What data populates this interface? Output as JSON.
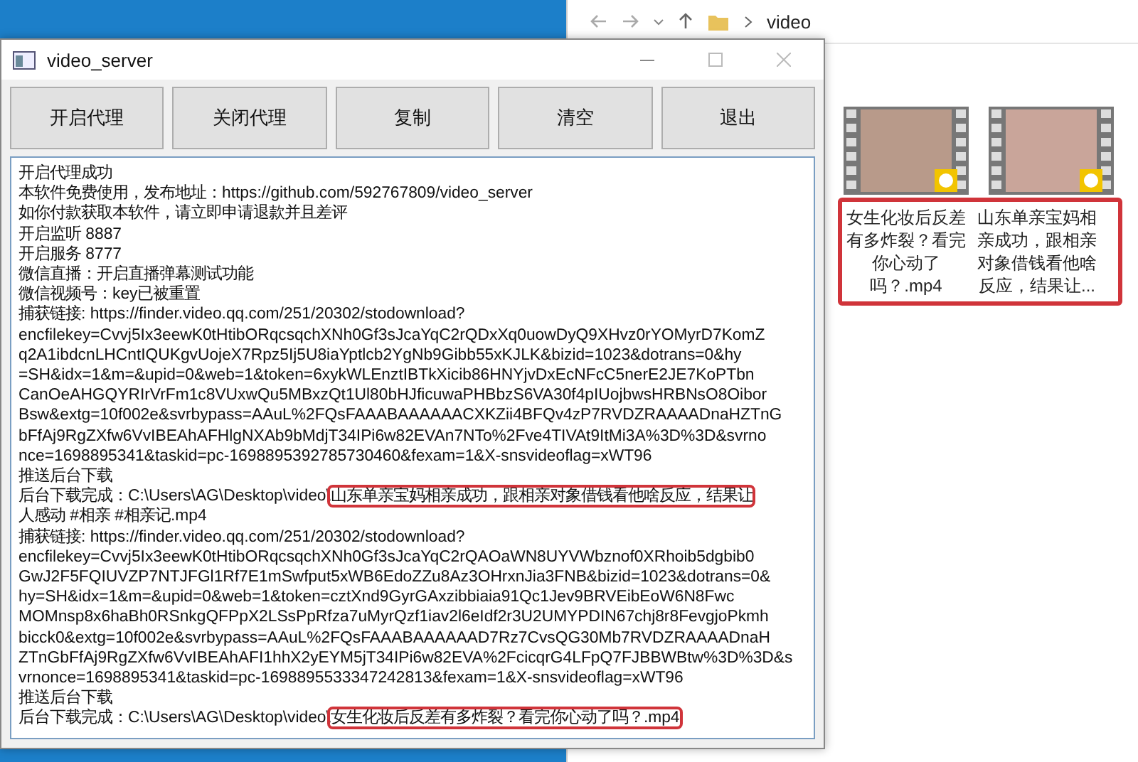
{
  "explorer": {
    "breadcrumb": "video",
    "files_highlighted": true,
    "files": [
      {
        "name": "女生化妆后反差有多炸裂？看完你心动了吗？.mp4"
      },
      {
        "name": "山东单亲宝妈相亲成功，跟相亲对象借钱看他啥反应，结果让..."
      }
    ]
  },
  "window": {
    "title": "video_server"
  },
  "buttons": [
    "开启代理",
    "关闭代理",
    "复制",
    "清空",
    "退出"
  ],
  "log": [
    {
      "text": "开启代理成功"
    },
    {
      "text": "本软件免费使用，发布地址：https://github.com/592767809/video_server"
    },
    {
      "text": "如你付款获取本软件，请立即申请退款并且差评"
    },
    {
      "text": "开启监听 8887"
    },
    {
      "text": "开启服务 8777"
    },
    {
      "text": "微信直播：开启直播弹幕测试功能"
    },
    {
      "text": "微信视频号：key已被重置"
    },
    {
      "text": "捕获链接: https://finder.video.qq.com/251/20302/stodownload?"
    },
    {
      "text": "encfilekey=Cvvj5Ix3eewK0tHtibORqcsqchXNh0Gf3sJcaYqC2rQDxXq0uowDyQ9XHvz0rYOMyrD7KomZ"
    },
    {
      "text": "q2A1ibdcnLHCntIQUKgvUojeX7Rpz5Ij5U8iaYptlcb2YgNb9Gibb55xKJLK&bizid=1023&dotrans=0&hy"
    },
    {
      "text": "=SH&idx=1&m=&upid=0&web=1&token=6xykWLEnztIBTkXicib86HNYjvDxEcNFcC5nerE2JE7KoPTbn"
    },
    {
      "text": "CanOeAHGQYRIrVrFm1c8VUxwQu5MBxzQt1Ul80bHJficuwaPHBbzS6VA30f4pIUojbwsHRBNsO8Oibor"
    },
    {
      "text": "Bsw&extg=10f002e&svrbypass=AAuL%2FQsFAAABAAAAAACXKZii4BFQv4zP7RVDZRAAAADnaHZTnG"
    },
    {
      "text": "bFfAj9RgZXfw6VvIBEAhAFHlgNXAb9bMdjT34IPi6w82EVAn7NTo%2Fve4TIVAt9ItMi3A%3D%3D&svrno"
    },
    {
      "text": "nce=1698895341&taskid=pc-1698895392785730460&fexam=1&X-snsvideoflag=xWT96"
    },
    {
      "text": "推送后台下载"
    },
    {
      "text": "后台下载完成：C:\\Users\\AG\\Desktop\\video\\",
      "highlight": "山东单亲宝妈相亲成功，跟相亲对象借钱看他啥反应，结果让"
    },
    {
      "text": "人感动 #相亲 #相亲记.mp4"
    },
    {
      "text": "捕获链接: https://finder.video.qq.com/251/20302/stodownload?"
    },
    {
      "text": "encfilekey=Cvvj5Ix3eewK0tHtibORqcsqchXNh0Gf3sJcaYqC2rQAOaWN8UYVWbznof0XRhoib5dgbib0"
    },
    {
      "text": "GwJ2F5FQIUVZP7NTJFGl1Rf7E1mSwfput5xWB6EdoZZu8Az3OHrxnJia3FNB&bizid=1023&dotrans=0&"
    },
    {
      "text": "hy=SH&idx=1&m=&upid=0&web=1&token=cztXnd9GyrGAxzibbiaia91Qc1Jev9BRVEibEoW6N8Fwc"
    },
    {
      "text": "MOMnsp8x6haBh0RSnkgQFPpX2LSsPpRfza7uMyrQzf1iav2l6eIdf2r3U2UMYPDIN67chj8r8FevgjoPkmh"
    },
    {
      "text": "bicck0&extg=10f002e&svrbypass=AAuL%2FQsFAAABAAAAAAD7Rz7CvsQG30Mb7RVDZRAAAADnaH"
    },
    {
      "text": "ZTnGbFfAj9RgZXfw6VvIBEAhAFI1hhX2yEYM5jT34IPi6w82EVA%2FcicqrG4LFpQ7FJBBWBtw%3D%3D&s"
    },
    {
      "text": "vrnonce=1698895341&taskid=pc-1698895533347242813&fexam=1&X-snsvideoflag=xWT96"
    },
    {
      "text": "推送后台下载"
    },
    {
      "text": "后台下载完成：C:\\Users\\AG\\Desktop\\video\\",
      "highlight": "女生化妆后反差有多炸裂？看完你心动了吗？.mp4"
    }
  ]
}
